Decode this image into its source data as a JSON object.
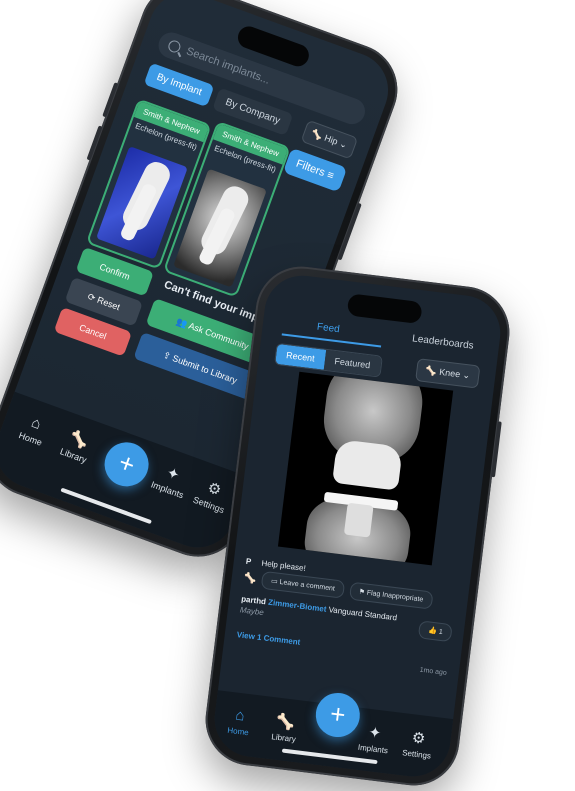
{
  "phone1": {
    "search_placeholder": "Search implants...",
    "tabs": [
      "By Implant",
      "By Company"
    ],
    "filters_label": "Filters",
    "joint_select": "Hip",
    "cards": [
      {
        "company": "Smith & Nephew",
        "name": "Echelon (press-fit)"
      },
      {
        "company": "Smith & Nephew",
        "name": "Echelon (press-fit)"
      }
    ],
    "actions": {
      "confirm": "Confirm",
      "reset": "Reset",
      "cancel": "Cancel"
    },
    "cant_find": "Can't find your implant?",
    "ask_community": "Ask Community",
    "submit_library": "Submit to Library",
    "nav": {
      "home": "Home",
      "library": "Library",
      "implants": "Implants",
      "settings": "Settings"
    },
    "fab": "+"
  },
  "phone2": {
    "tabs": {
      "feed": "Feed",
      "leaderboards": "Leaderboards"
    },
    "segments": [
      "Recent",
      "Featured"
    ],
    "joint_select": "Knee",
    "post": {
      "avatar_initial": "P",
      "caption": "Help please!",
      "leave_comment": "Leave a comment",
      "flag": "Flag Inappropriate",
      "user": "parthd",
      "company": "Zimmer-Biomet",
      "implant": "Vanguard Standard",
      "status": "Maybe",
      "likes": "1",
      "view_comments": "View 1 Comment",
      "time": "1mo ago"
    },
    "nav": {
      "home": "Home",
      "library": "Library",
      "implants": "Implants",
      "settings": "Settings"
    },
    "fab": "+"
  },
  "colors": {
    "accent": "#3d9be6",
    "green": "#3cae76",
    "red": "#e06262"
  }
}
